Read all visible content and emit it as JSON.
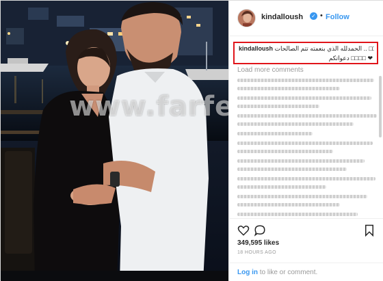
{
  "post": {
    "username": "kindalloush",
    "verified_badge": "✓",
    "separator": "•",
    "follow_label": "Follow",
    "caption_username": "kindalloush",
    "caption_line1": "الحمدلله الذي بنعمته تتم الصالحات .. □□",
    "caption_line2": "دعواتكم □□□□ ❤",
    "load_more": "Load more comments",
    "likes": "349,595 likes",
    "timestamp": "18 HOURS AGO",
    "login_link": "Log in",
    "login_rest": " to like or comment."
  },
  "watermark": "www.farfesh.com",
  "icons": {
    "heart": "heart-icon",
    "comment": "comment-icon",
    "bookmark": "bookmark-icon",
    "verified": "verified-badge-icon"
  },
  "colors": {
    "accent": "#3897f0",
    "highlight_box": "#e0141a",
    "muted": "#999999"
  }
}
